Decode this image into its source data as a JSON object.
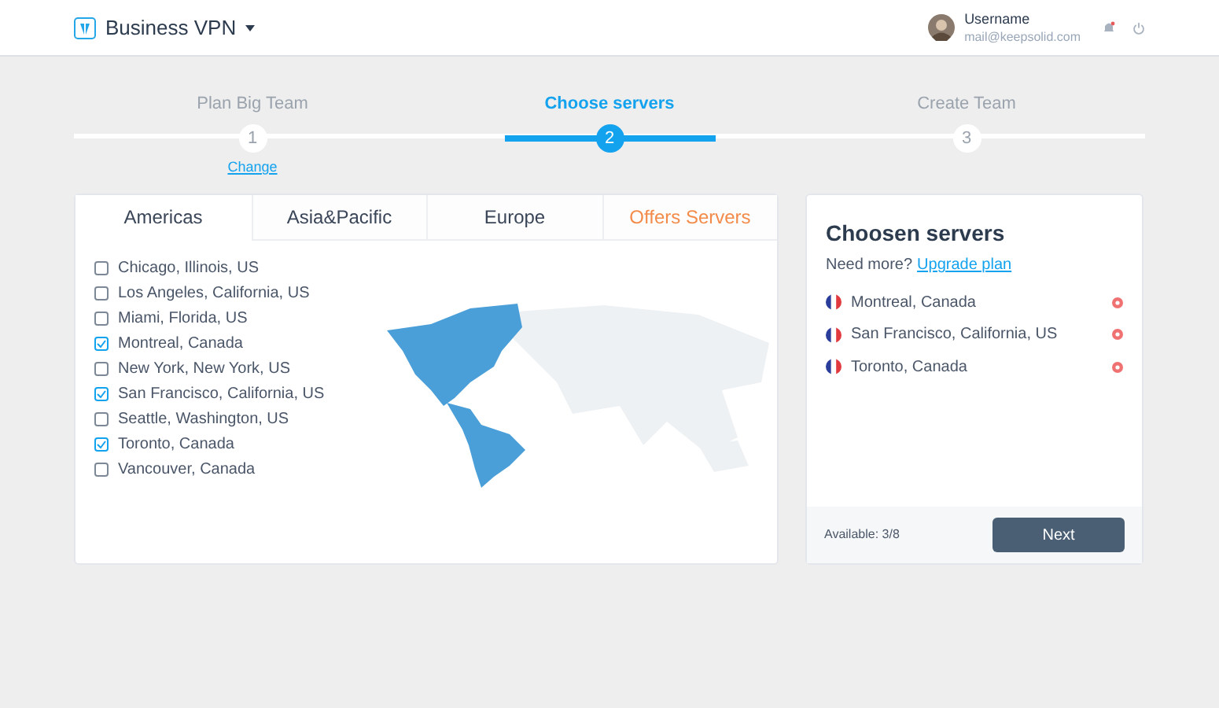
{
  "header": {
    "brand": "Business VPN",
    "user": {
      "name": "Username",
      "email": "mail@keepsolid.com"
    }
  },
  "steps": [
    {
      "label": "Plan Big Team",
      "number": "1",
      "selected": false,
      "link": "Change"
    },
    {
      "label": "Choose servers",
      "number": "2",
      "selected": true
    },
    {
      "label": "Create Team",
      "number": "3",
      "selected": false
    }
  ],
  "tabs": [
    {
      "label": "Americas",
      "selected": true,
      "kind": "region"
    },
    {
      "label": "Asia&Pacific",
      "selected": false,
      "kind": "region"
    },
    {
      "label": "Europe",
      "selected": false,
      "kind": "region"
    },
    {
      "label": "Offers Servers",
      "selected": false,
      "kind": "offers"
    }
  ],
  "servers": [
    {
      "name": "Chicago, Illinois, US",
      "checked": false
    },
    {
      "name": "Los Angeles, California, US",
      "checked": false
    },
    {
      "name": "Miami, Florida, US",
      "checked": false
    },
    {
      "name": "Montreal, Canada",
      "checked": true
    },
    {
      "name": "New York, New York, US",
      "checked": false
    },
    {
      "name": "San Francisco, California, US",
      "checked": true
    },
    {
      "name": "Seattle, Washington, US",
      "checked": false
    },
    {
      "name": "Toronto, Canada",
      "checked": true
    },
    {
      "name": "Vancouver, Canada",
      "checked": false
    }
  ],
  "chosen": {
    "title": "Choosen servers",
    "prompt": "Need more?",
    "link": "Upgrade plan",
    "items": [
      "Montreal, Canada",
      "San Francisco, California, US",
      "Toronto, Canada"
    ],
    "available": "Available: 3/8",
    "button": "Next"
  }
}
